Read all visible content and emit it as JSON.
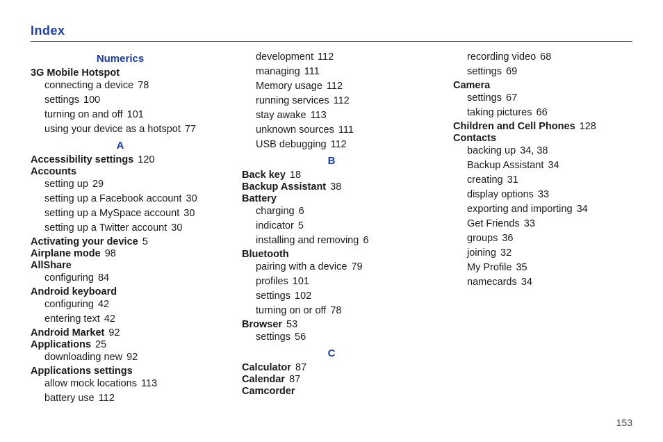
{
  "title": "Index",
  "pageNumber": "153",
  "blocks": [
    {
      "type": "head",
      "text": "Numerics"
    },
    {
      "type": "topic",
      "text": "3G Mobile Hotspot",
      "page": ""
    },
    {
      "type": "entry",
      "text": "connecting a device",
      "page": "78"
    },
    {
      "type": "entry",
      "text": "settings",
      "page": "100"
    },
    {
      "type": "entry",
      "text": "turning on and off",
      "page": "101"
    },
    {
      "type": "entry",
      "text": "using your device as a hotspot",
      "page": "77"
    },
    {
      "type": "head",
      "text": "A"
    },
    {
      "type": "topic",
      "text": "Accessibility settings",
      "page": "120"
    },
    {
      "type": "topic",
      "text": "Accounts",
      "page": ""
    },
    {
      "type": "entry",
      "text": "setting up",
      "page": "29"
    },
    {
      "type": "entry",
      "text": "setting up a Facebook account",
      "page": "30"
    },
    {
      "type": "entry",
      "text": "setting up a MySpace account",
      "page": "30"
    },
    {
      "type": "entry",
      "text": "setting up a Twitter account",
      "page": "30"
    },
    {
      "type": "topic",
      "text": "Activating your device",
      "page": "5"
    },
    {
      "type": "topic",
      "text": "Airplane mode",
      "page": "98"
    },
    {
      "type": "topic",
      "text": "AllShare",
      "page": ""
    },
    {
      "type": "entry",
      "text": "configuring",
      "page": "84"
    },
    {
      "type": "topic",
      "text": "Android keyboard",
      "page": ""
    },
    {
      "type": "entry",
      "text": "configuring",
      "page": "42"
    },
    {
      "type": "entry",
      "text": "entering text",
      "page": "42"
    },
    {
      "type": "topic",
      "text": "Android Market",
      "page": "92"
    },
    {
      "type": "topic",
      "text": "Applications",
      "page": "25"
    },
    {
      "type": "entry",
      "text": "downloading new",
      "page": "92"
    },
    {
      "type": "topic",
      "text": "Applications settings",
      "page": ""
    },
    {
      "type": "entry",
      "text": "allow mock locations",
      "page": "113"
    },
    {
      "type": "entry",
      "text": "battery use",
      "page": "112"
    },
    {
      "type": "entry",
      "text": "development",
      "page": "112"
    },
    {
      "type": "entry",
      "text": "managing",
      "page": "111"
    },
    {
      "type": "entry",
      "text": "Memory usage",
      "page": "112"
    },
    {
      "type": "entry",
      "text": "running services",
      "page": "112"
    },
    {
      "type": "entry",
      "text": "stay awake",
      "page": "113"
    },
    {
      "type": "entry",
      "text": "unknown sources",
      "page": "111"
    },
    {
      "type": "entry",
      "text": "USB debugging",
      "page": "112"
    },
    {
      "type": "head",
      "text": "B"
    },
    {
      "type": "topic",
      "text": "Back key",
      "page": "18"
    },
    {
      "type": "topic",
      "text": "Backup Assistant",
      "page": "38"
    },
    {
      "type": "topic",
      "text": "Battery",
      "page": ""
    },
    {
      "type": "entry",
      "text": "charging",
      "page": "6"
    },
    {
      "type": "entry",
      "text": "indicator",
      "page": "5"
    },
    {
      "type": "entry",
      "text": "installing and removing",
      "page": "6"
    },
    {
      "type": "topic",
      "text": "Bluetooth",
      "page": ""
    },
    {
      "type": "entry",
      "text": "pairing with a device",
      "page": "79"
    },
    {
      "type": "entry",
      "text": "profiles",
      "page": "101"
    },
    {
      "type": "entry",
      "text": "settings",
      "page": "102"
    },
    {
      "type": "entry",
      "text": "turning on or off",
      "page": "78"
    },
    {
      "type": "topic",
      "text": "Browser",
      "page": "53"
    },
    {
      "type": "entry",
      "text": "settings",
      "page": "56"
    },
    {
      "type": "head",
      "text": "C"
    },
    {
      "type": "topic",
      "text": "Calculator",
      "page": "87"
    },
    {
      "type": "topic",
      "text": "Calendar",
      "page": "87"
    },
    {
      "type": "topic",
      "text": "Camcorder",
      "page": ""
    },
    {
      "type": "entry",
      "text": "recording video",
      "page": "68"
    },
    {
      "type": "entry",
      "text": "settings",
      "page": "69"
    },
    {
      "type": "topic",
      "text": "Camera",
      "page": ""
    },
    {
      "type": "entry",
      "text": "settings",
      "page": "67"
    },
    {
      "type": "entry",
      "text": "taking pictures",
      "page": "66"
    },
    {
      "type": "topic",
      "text": "Children and Cell Phones",
      "page": "128"
    },
    {
      "type": "topic",
      "text": "Contacts",
      "page": ""
    },
    {
      "type": "entry",
      "text": "backing up",
      "page": "34, 38"
    },
    {
      "type": "entry",
      "text": "Backup Assistant",
      "page": "34"
    },
    {
      "type": "entry",
      "text": "creating",
      "page": "31"
    },
    {
      "type": "entry",
      "text": "display options",
      "page": "33"
    },
    {
      "type": "entry",
      "text": "exporting and importing",
      "page": "34"
    },
    {
      "type": "entry",
      "text": "Get Friends",
      "page": "33"
    },
    {
      "type": "entry",
      "text": "groups",
      "page": "36"
    },
    {
      "type": "entry",
      "text": "joining",
      "page": "32"
    },
    {
      "type": "entry",
      "text": "My Profile",
      "page": "35"
    },
    {
      "type": "entry",
      "text": "namecards",
      "page": "34"
    }
  ]
}
